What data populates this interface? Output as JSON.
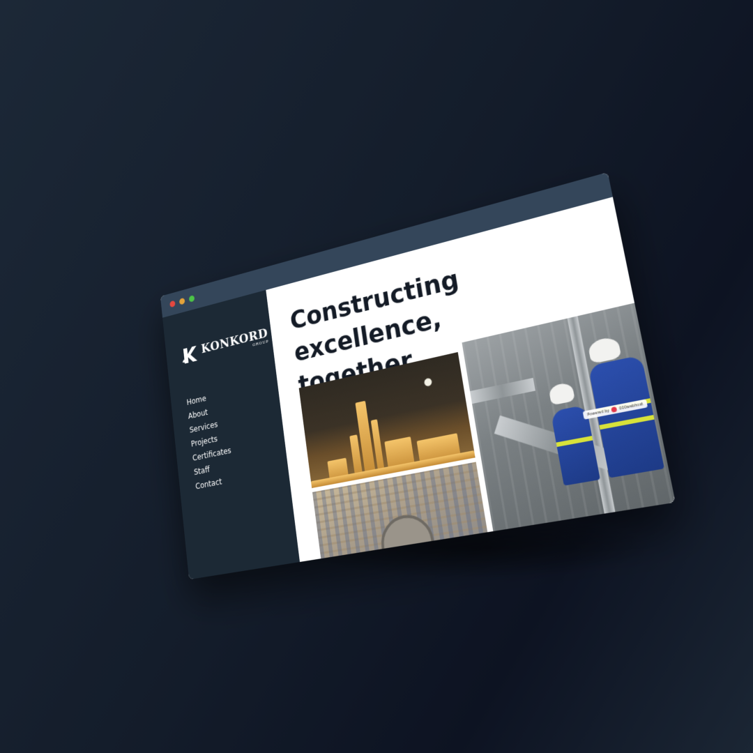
{
  "window": {
    "controls": [
      {
        "name": "close",
        "color": "#e5483f"
      },
      {
        "name": "minimize",
        "color": "#e5a33a"
      },
      {
        "name": "maximize",
        "color": "#4cc447"
      }
    ]
  },
  "brand": {
    "name": "KONKORD",
    "sub": "GROUP",
    "mark_letter": "K"
  },
  "nav": {
    "items": [
      "Home",
      "About",
      "Services",
      "Projects",
      "Certificates",
      "Staff",
      "Contact"
    ]
  },
  "hero": {
    "headline_line1": "Constructing excellence,",
    "headline_line2": "together."
  },
  "photos": {
    "refinery_alt": "refinery-at-night-photo",
    "aerial_alt": "aerial-construction-site-photo",
    "worker_alt": "worker-inspecting-pipes-photo"
  },
  "badge": {
    "prefix": "Powered by",
    "brand": "000webhost"
  },
  "colors": {
    "sidebar": "#1c2935",
    "titlebar": "#34465a",
    "headline": "#141b26"
  }
}
